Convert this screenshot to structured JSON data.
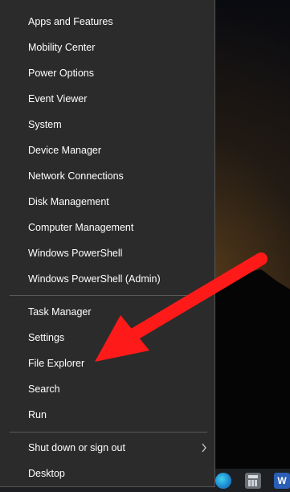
{
  "menu": {
    "group1": [
      "Apps and Features",
      "Mobility Center",
      "Power Options",
      "Event Viewer",
      "System",
      "Device Manager",
      "Network Connections",
      "Disk Management",
      "Computer Management",
      "Windows PowerShell",
      "Windows PowerShell (Admin)"
    ],
    "group2": [
      "Task Manager",
      "Settings",
      "File Explorer",
      "Search",
      "Run"
    ],
    "group3": [
      "Shut down or sign out",
      "Desktop"
    ]
  },
  "taskbar": {
    "icons": [
      "edge-icon",
      "calculator-icon",
      "word-icon"
    ],
    "word_letter": "W"
  },
  "colors": {
    "arrow": "#ff1a1a",
    "menu_bg": "#2b2b2b",
    "text": "#ffffff"
  }
}
